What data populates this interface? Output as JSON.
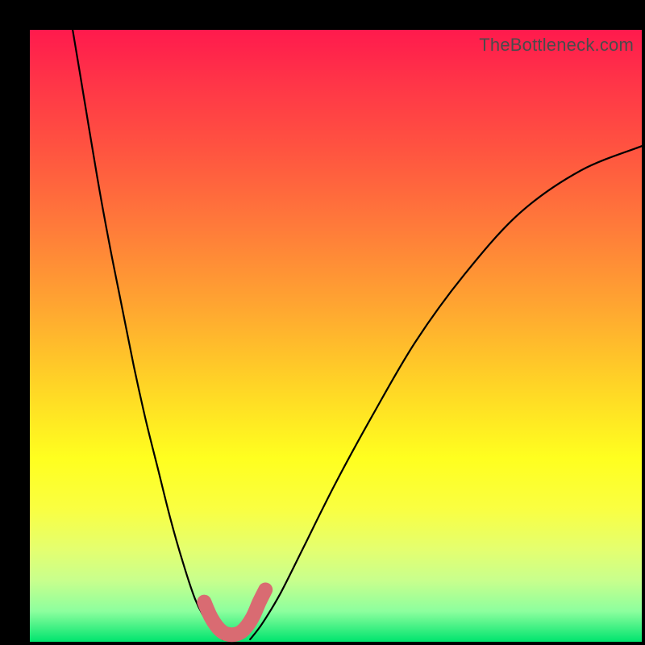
{
  "watermark": "TheBottleneck.com",
  "chart_data": {
    "type": "line",
    "title": "",
    "xlabel": "",
    "ylabel": "",
    "xlim": [
      0,
      100
    ],
    "ylim": [
      0,
      100
    ],
    "series": [
      {
        "name": "left-curve",
        "x": [
          7,
          9,
          11,
          13,
          15,
          17,
          19,
          21,
          23,
          25,
          27,
          28.5,
          30,
          31.5
        ],
        "y": [
          100,
          88,
          76,
          65,
          55,
          45,
          36,
          28,
          20,
          13,
          7,
          4,
          2,
          0.4
        ]
      },
      {
        "name": "right-curve",
        "x": [
          36,
          38,
          41,
          45,
          50,
          56,
          63,
          71,
          80,
          90,
          100
        ],
        "y": [
          0.4,
          3,
          8,
          16,
          26,
          37,
          49,
          60,
          70,
          77,
          81
        ]
      },
      {
        "name": "bottom-u-marker",
        "x": [
          28.5,
          29.5,
          30.5,
          31.5,
          32.5,
          33.5,
          34.5,
          35.5,
          36.5,
          37.5,
          38.5
        ],
        "y": [
          6.5,
          4.2,
          2.6,
          1.6,
          1.2,
          1.2,
          1.6,
          2.6,
          4.2,
          6.5,
          8.5
        ]
      }
    ],
    "gradient_stops": [
      {
        "pos": 0.0,
        "color": "#ff1a4d"
      },
      {
        "pos": 0.2,
        "color": "#ff5540"
      },
      {
        "pos": 0.45,
        "color": "#ffa531"
      },
      {
        "pos": 0.7,
        "color": "#ffff1f"
      },
      {
        "pos": 0.9,
        "color": "#c8ff8d"
      },
      {
        "pos": 1.0,
        "color": "#00e46e"
      }
    ]
  }
}
